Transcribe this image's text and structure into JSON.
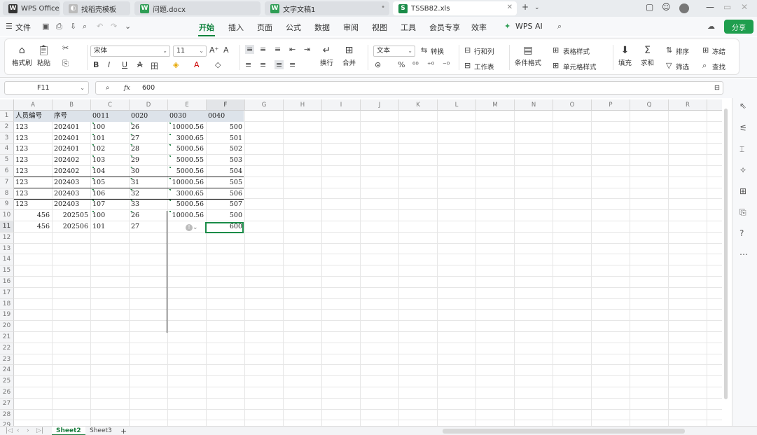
{
  "tabs": [
    {
      "label": "WPS Office",
      "icon": "wps-logo-icon"
    },
    {
      "label": "找稻壳模板",
      "icon": "docer-icon"
    },
    {
      "label": "问题.docx",
      "icon": "word-doc-icon"
    },
    {
      "label": "文字文稿1",
      "icon": "word-doc-icon"
    },
    {
      "label": "TSSB82.xls",
      "icon": "spreadsheet-icon"
    }
  ],
  "menu": {
    "file": "文件",
    "items": [
      "开始",
      "插入",
      "页面",
      "公式",
      "数据",
      "审阅",
      "视图",
      "工具",
      "会员专享",
      "效率"
    ],
    "active": "开始",
    "wps_ai": "WPS AI",
    "share": "分享"
  },
  "ribbon": {
    "format_painter": "格式刷",
    "paste": "粘贴",
    "font_name": "宋体",
    "font_size": "11",
    "wrap": "换行",
    "merge": "合并",
    "number_format": "文本",
    "convert": "转换",
    "row_col": "行和列",
    "worksheet": "工作表",
    "cond_format": "条件格式",
    "table_style": "表格样式",
    "cell_style": "单元格样式",
    "fill": "填充",
    "sum": "求和",
    "sort": "排序",
    "filter": "筛选",
    "freeze": "冻结",
    "find": "查找"
  },
  "formula": {
    "cell": "F11",
    "fx": "fx",
    "value": "600"
  },
  "columns": [
    "A",
    "B",
    "C",
    "D",
    "E",
    "F",
    "G",
    "H",
    "I",
    "J",
    "K",
    "L",
    "M",
    "N",
    "O",
    "P",
    "Q",
    "R",
    "S"
  ],
  "rows": [
    "1",
    "2",
    "3",
    "4",
    "5",
    "6",
    "7",
    "8",
    "9",
    "10",
    "11",
    "12",
    "13",
    "14",
    "15",
    "16",
    "17",
    "18",
    "19",
    "20",
    "21",
    "22",
    "23",
    "24",
    "25",
    "26",
    "27",
    "28",
    "29"
  ],
  "table": {
    "headers": [
      "人员编号",
      "序号",
      "0011",
      "0020",
      "0030",
      "0040"
    ],
    "data": [
      [
        "123",
        "202401",
        "100",
        "26",
        "10000.56",
        "500"
      ],
      [
        "123",
        "202401",
        "101",
        "27",
        "3000.65",
        "501"
      ],
      [
        "123",
        "202401",
        "102",
        "28",
        "5000.56",
        "502"
      ],
      [
        "123",
        "202402",
        "103",
        "29",
        "5000.55",
        "503"
      ],
      [
        "123",
        "202402",
        "104",
        "30",
        "5000.56",
        "504"
      ],
      [
        "123",
        "202403",
        "105",
        "31",
        "10000.56",
        "505"
      ],
      [
        "123",
        "202403",
        "106",
        "32",
        "3000.65",
        "506"
      ],
      [
        "123",
        "202403",
        "107",
        "33",
        "5000.56",
        "507"
      ],
      [
        "456",
        "202505",
        "100",
        "26",
        "10000.56",
        "500"
      ],
      [
        "456",
        "202506",
        "101",
        "27",
        "",
        "600"
      ]
    ]
  },
  "sheets": [
    "Sheet2",
    "Sheet3"
  ],
  "active_sheet": "Sheet2",
  "accent": "#10833e"
}
